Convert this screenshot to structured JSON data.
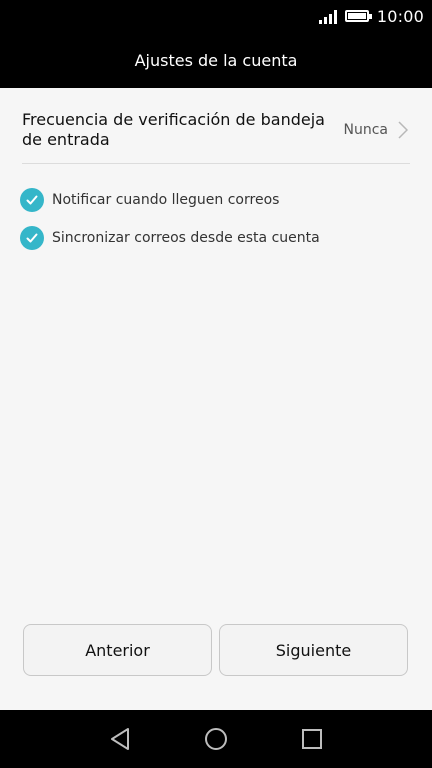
{
  "status_bar": {
    "time": "10:00",
    "signal_icon": "signal-bars-icon",
    "battery_icon": "battery-icon"
  },
  "header": {
    "title": "Ajustes de la cuenta"
  },
  "settings": {
    "inbox_check_frequency": {
      "label": "Frecuencia de verificación de bandeja de entrada",
      "value": "Nunca",
      "icon": "chevron-right-icon"
    }
  },
  "options": [
    {
      "label": "Notificar cuando lleguen correos",
      "checked": true
    },
    {
      "label": "Sincronizar correos desde esta cuenta",
      "checked": true
    }
  ],
  "buttons": {
    "previous": "Anterior",
    "next": "Siguiente"
  },
  "nav_bar": {
    "back_icon": "back-triangle-icon",
    "home_icon": "home-circle-icon",
    "recents_icon": "recents-square-icon"
  },
  "colors": {
    "accent": "#35b6c9",
    "topbar": "#000000",
    "background": "#f6f6f6"
  }
}
